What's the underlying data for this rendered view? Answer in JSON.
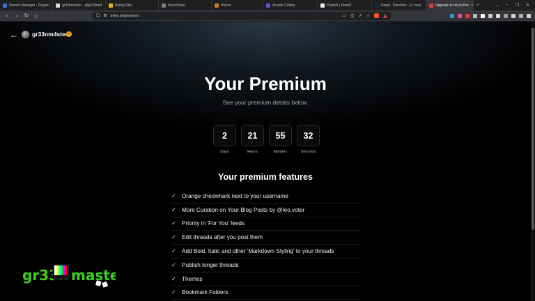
{
  "browser": {
    "tabs": [
      {
        "label": "Stream Manager - Dagam",
        "color": "#3b6fd8",
        "active": false
      },
      {
        "label": "gr33nm4ster - @gr33nm4",
        "color": "#dddddd",
        "active": false
      },
      {
        "label": "Rising Star",
        "color": "#f2b01e",
        "active": false
      },
      {
        "label": "NeonStrike",
        "color": "#7a7a7a",
        "active": false
      },
      {
        "label": "Hueso",
        "color": "#c87d2a",
        "active": false
      },
      {
        "label": "Arcade Colony",
        "color": "#6d4ac7",
        "active": false
      },
      {
        "label": "Publish | PeakD",
        "color": "#e8e8e8",
        "active": false
      },
      {
        "label": "DeepL Translate - El mejo",
        "color": "#0f2b46",
        "active": false
      },
      {
        "label": "Upgrade to InLeo Pre",
        "color": "#e23b3b",
        "active": true
      }
    ],
    "url": "inleo.io/premium"
  },
  "page": {
    "user": {
      "name": "gr33nm4ster"
    },
    "title": "Your Premium",
    "subtitle": "See your premium details below.",
    "countdown": [
      {
        "value": "2",
        "label": "Days"
      },
      {
        "value": "21",
        "label": "Hours"
      },
      {
        "value": "55",
        "label": "Minutes"
      },
      {
        "value": "32",
        "label": "Seconds"
      }
    ],
    "features_title": "Your premium features",
    "features": [
      "Orange checkmark next to your username",
      "More Curation on Your Blog Posts by @leo.voter",
      "Priority in 'For You' feeds",
      "Edit threads after you post them",
      "Add Bold, Italic and other 'Markdown Styling' to your threads",
      "Publish longer threads",
      "Themes",
      "Bookmark Folders"
    ]
  },
  "overlay": {
    "logo_text": "gr33nm4ster"
  },
  "colors": {
    "verified": "#f5a623",
    "logo_green": "#3cd01e",
    "background": "#000000"
  }
}
